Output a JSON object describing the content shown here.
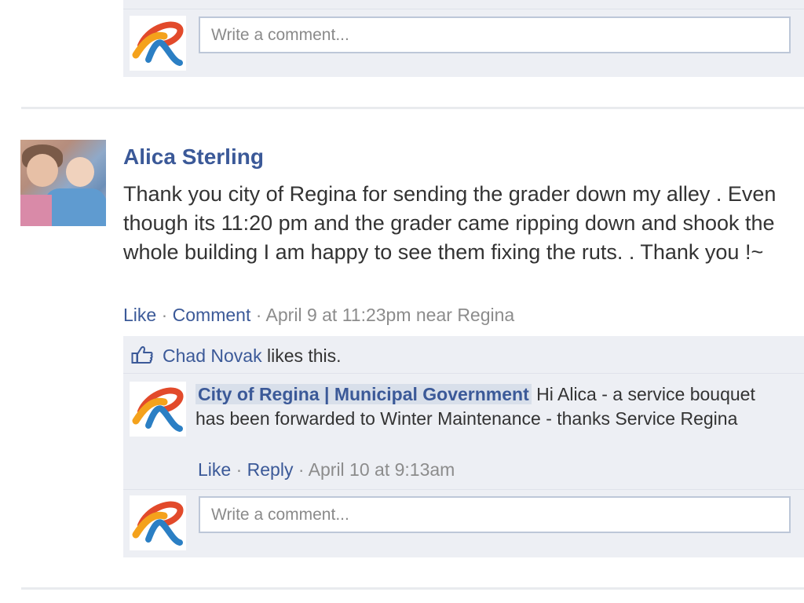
{
  "top_comment_box": {
    "placeholder": "Write a comment..."
  },
  "post": {
    "author": "Alica Sterling",
    "text": "Thank you city of Regina for sending the grader down my alley . Even though its 11:20 pm and the grader came ripping down and shook the whole building I am happy to see them fixing the ruts. . Thank you !~",
    "actions": {
      "like": "Like",
      "comment": "Comment",
      "separator": "·",
      "timestamp": "April 9 at 11:23pm near Regina"
    },
    "likes": {
      "liker": "Chad Novak",
      "suffix": "likes this."
    },
    "reply": {
      "author": "City of Regina | Municipal Government",
      "text": "Hi Alica - a service bouquet has been forwarded to Winter Maintenance - thanks Service Regina",
      "like": "Like",
      "reply": "Reply",
      "timestamp": "April 10 at 9:13am"
    },
    "comment_box": {
      "placeholder": "Write a comment..."
    }
  },
  "colors": {
    "link": "#3b5998",
    "panel": "#edeff4",
    "muted": "#8c8c8c"
  },
  "icons": {
    "brand_logo": "city-of-regina-logo-icon",
    "like": "thumbs-up-icon"
  }
}
